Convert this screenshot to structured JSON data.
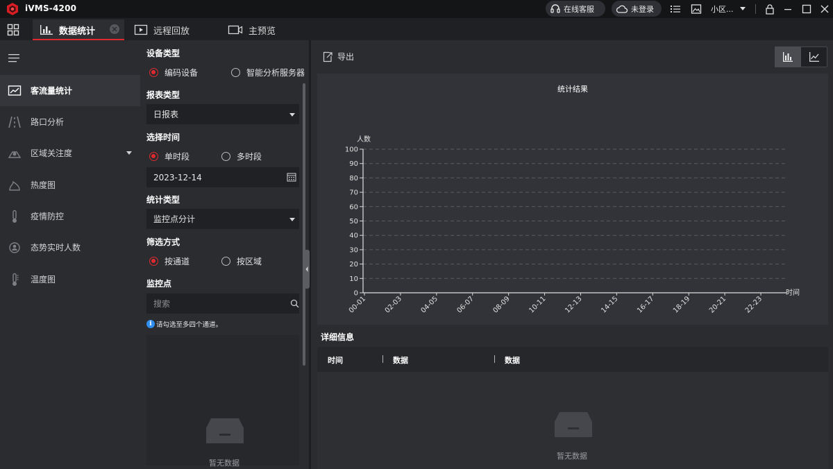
{
  "app": {
    "title": "iVMS-4200"
  },
  "titlebar": {
    "support_label": "在线客服",
    "login_label": "未登录",
    "user_label": "小区..."
  },
  "tabs": [
    {
      "label": "数据统计",
      "active": true
    },
    {
      "label": "远程回放",
      "active": false
    },
    {
      "label": "主预览",
      "active": false
    }
  ],
  "nav": {
    "items": [
      {
        "label": "客流量统计",
        "icon": "people-count-icon",
        "active": true
      },
      {
        "label": "路口分析",
        "icon": "road-icon"
      },
      {
        "label": "区域关注度",
        "icon": "area-heat-icon",
        "has_submenu": true
      },
      {
        "label": "热度图",
        "icon": "heatmap-icon"
      },
      {
        "label": "疫情防控",
        "icon": "thermometer-icon"
      },
      {
        "label": "态势实时人数",
        "icon": "realtime-people-icon"
      },
      {
        "label": "温度图",
        "icon": "temperature-icon"
      }
    ]
  },
  "filter": {
    "device_type": {
      "title": "设备类型",
      "options": [
        "编码设备",
        "智能分析服务器"
      ],
      "selected": 0
    },
    "report_type": {
      "title": "报表类型",
      "value": "日报表"
    },
    "time": {
      "title": "选择时间",
      "options": [
        "单时段",
        "多时段"
      ],
      "selected": 0,
      "date": "2023-12-14"
    },
    "stat_type": {
      "title": "统计类型",
      "value": "监控点分计"
    },
    "filter_mode": {
      "title": "筛选方式",
      "options": [
        "按通道",
        "按区域"
      ],
      "selected": 0
    },
    "monitor": {
      "title": "监控点",
      "search_placeholder": "搜索",
      "hint": "请勾选至多四个通道。",
      "empty_text": "暂无数据"
    }
  },
  "main": {
    "export_label": "导出",
    "detail_title": "详细信息",
    "table": {
      "headers": [
        "时间",
        "数据",
        "数据"
      ],
      "empty_text": "暂无数据"
    }
  },
  "colors": {
    "accent": "#e0292f",
    "info": "#2f8ef0"
  },
  "chart_data": {
    "type": "bar",
    "title": "统计结果",
    "ylabel": "人数",
    "xlabel": "时间",
    "ylim": [
      0,
      100
    ],
    "yticks": [
      0,
      10,
      20,
      30,
      40,
      50,
      60,
      70,
      80,
      90,
      100
    ],
    "categories": [
      "00-01",
      "02-03",
      "04-05",
      "06-07",
      "08-09",
      "10-11",
      "12-13",
      "14-15",
      "16-17",
      "18-19",
      "20-21",
      "22-23"
    ],
    "series": [],
    "grid": true
  }
}
